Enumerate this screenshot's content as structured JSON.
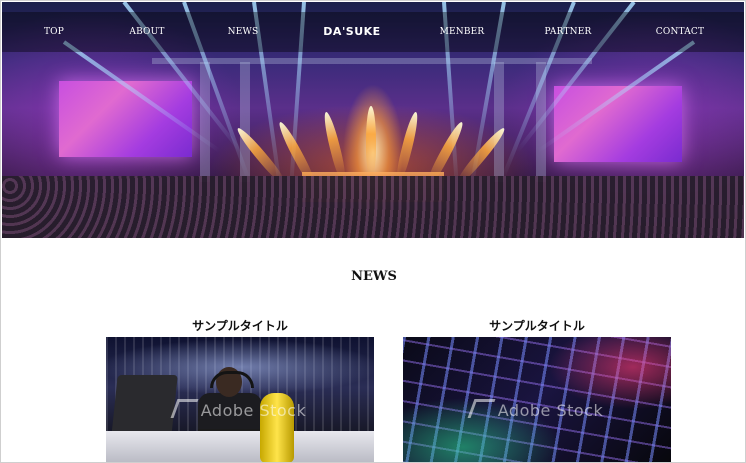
{
  "nav": {
    "items": [
      {
        "label": "TOP"
      },
      {
        "label": "ABOUT"
      },
      {
        "label": "NEWS"
      },
      {
        "label": "MENBER"
      },
      {
        "label": "PARTNER"
      },
      {
        "label": "CONTACT"
      }
    ],
    "logo": "DA'SUKE"
  },
  "hero": {
    "image": "esports-arena-stage-icon"
  },
  "news": {
    "title": "NEWS",
    "cards": [
      {
        "title": "サンプルタイトル",
        "watermark": "Adobe Stock",
        "image": "gamer-at-desk-image"
      },
      {
        "title": "サンプルタイトル",
        "watermark": "Adobe Stock",
        "image": "rgb-keyboard-image"
      }
    ]
  },
  "colors": {
    "nav_bg": "#00000060",
    "text": "#111111",
    "background": "#ffffff"
  }
}
